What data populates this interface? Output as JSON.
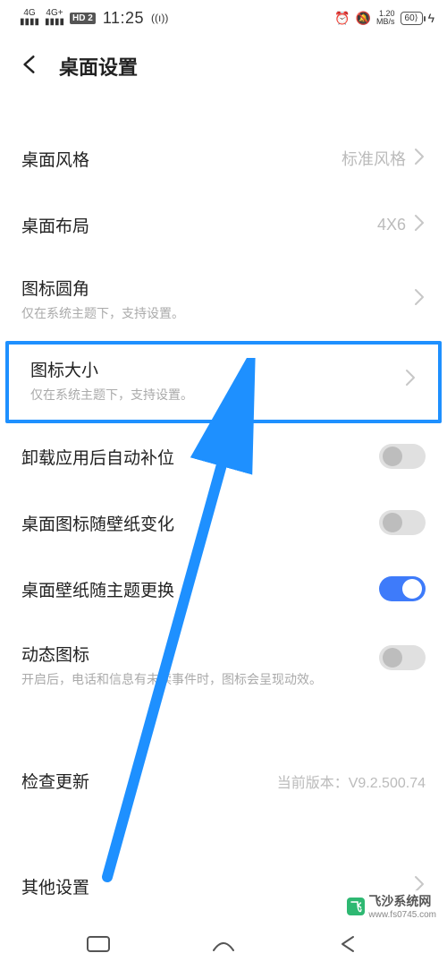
{
  "status": {
    "sig1_top": "4G",
    "sig2_top": "4G+",
    "hd": "HD 2",
    "time": "11:25",
    "net_speed_top": "1.20",
    "net_speed_bot": "MB/s",
    "battery": "60"
  },
  "header": {
    "title": "桌面设置"
  },
  "rows": {
    "style": {
      "label": "桌面风格",
      "value": "标准风格"
    },
    "layout": {
      "label": "桌面布局",
      "value": "4X6"
    },
    "corner": {
      "label": "图标圆角",
      "sub": "仅在系统主题下，支持设置。"
    },
    "size": {
      "label": "图标大小",
      "sub": "仅在系统主题下，支持设置。"
    },
    "autofill": {
      "label": "卸载应用后自动补位"
    },
    "wallicon": {
      "label": "桌面图标随壁纸变化"
    },
    "theme": {
      "label": "桌面壁纸随主题更换"
    },
    "dynicon": {
      "label": "动态图标",
      "sub": "开启后，电话和信息有未读事件时，图标会呈现动效。"
    },
    "update": {
      "label": "检查更新",
      "value": "当前版本：V9.2.500.74"
    },
    "other": {
      "label": "其他设置"
    }
  },
  "watermark": {
    "name": "飞沙系统网",
    "url": "www.fs0745.com",
    "logo": "飞"
  }
}
